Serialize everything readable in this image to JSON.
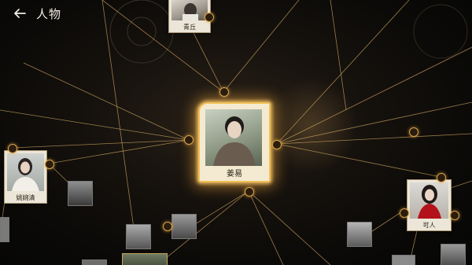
{
  "header": {
    "back_icon": "arrow-left-icon",
    "title": "人物"
  },
  "center_character": {
    "name": "姜易"
  },
  "characters": [
    {
      "id": "qingqiu",
      "name": "青丘"
    },
    {
      "id": "yaowanqing",
      "name": "姚婉清"
    },
    {
      "id": "keren",
      "name": "可人"
    }
  ],
  "colors": {
    "accent": "#f2bf55",
    "line": "#d9b36a",
    "background": "#0b0a08"
  }
}
